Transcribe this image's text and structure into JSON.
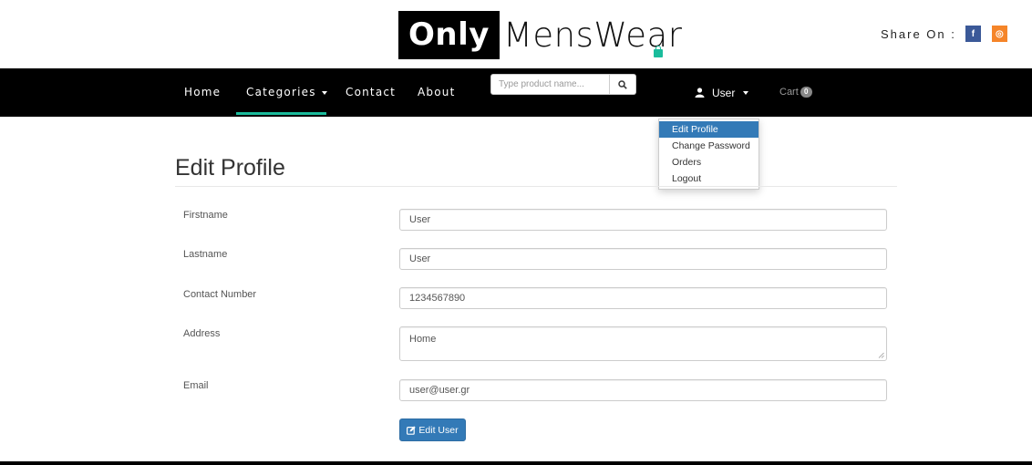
{
  "header": {
    "logo_bold": "Only",
    "logo_light": "MensWear",
    "share_label": "Share On :",
    "share_facebook_glyph": "f",
    "share_instagram_glyph": "◎"
  },
  "navbar": {
    "items": [
      {
        "label": "Home"
      },
      {
        "label": "Categories"
      },
      {
        "label": "Contact"
      },
      {
        "label": "About"
      }
    ],
    "active_item": "Categories",
    "accent_color": "#1abc9c",
    "search": {
      "placeholder": "Type product name...",
      "value": "",
      "icon": "search-icon"
    },
    "user_label": "User",
    "cart_label": "Cart",
    "cart_count": "0"
  },
  "user_dropdown": {
    "items": [
      {
        "label": "Edit Profile",
        "active": true
      },
      {
        "label": "Change Password",
        "active": false
      },
      {
        "label": "Orders",
        "active": false
      },
      {
        "label": "Logout",
        "active": false
      }
    ],
    "active_color": "#337ab7"
  },
  "form": {
    "title": "Edit Profile",
    "fields": [
      {
        "label": "Firstname",
        "value": "User"
      },
      {
        "label": "Lastname",
        "value": "User"
      },
      {
        "label": "Contact Number",
        "value": "1234567890"
      },
      {
        "label": "Address",
        "value": "Home"
      },
      {
        "label": "Email",
        "value": "user@user.gr"
      }
    ],
    "submit_label": "Edit User",
    "submit_icon": "edit-icon",
    "submit_color": "#337ab7"
  }
}
